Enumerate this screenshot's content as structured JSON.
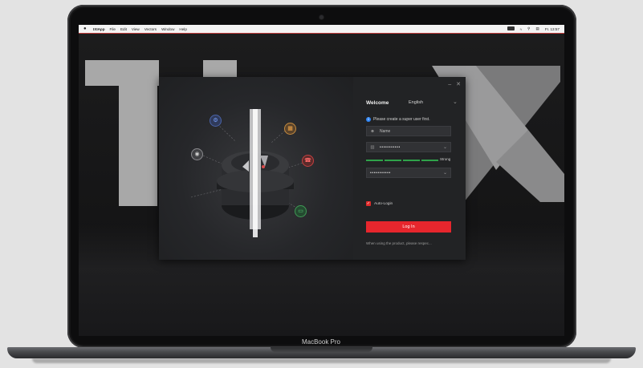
{
  "device": {
    "brand_label": "MacBook Pro"
  },
  "menubar": {
    "items": [
      "IXIApp",
      "File",
      "Edit",
      "View",
      "Vectors",
      "Window",
      "Help"
    ],
    "clock": "Fr. 13:57"
  },
  "window": {
    "welcome": "Welcome",
    "language": "English",
    "hint": "Please create a super user first.",
    "username": {
      "placeholder": "Name",
      "value": ""
    },
    "password": {
      "value": "•••••••••••"
    },
    "strength_label": "Strong",
    "confirm_password": {
      "value": "•••••••••••"
    },
    "auto_login": {
      "label": "Auto-Login",
      "checked": true
    },
    "login_label": "Log In",
    "legal_text": "When using the product, please respec..."
  },
  "colors": {
    "accent": "#e7262d",
    "strength": "#2fa24a",
    "info": "#2f86f6"
  }
}
